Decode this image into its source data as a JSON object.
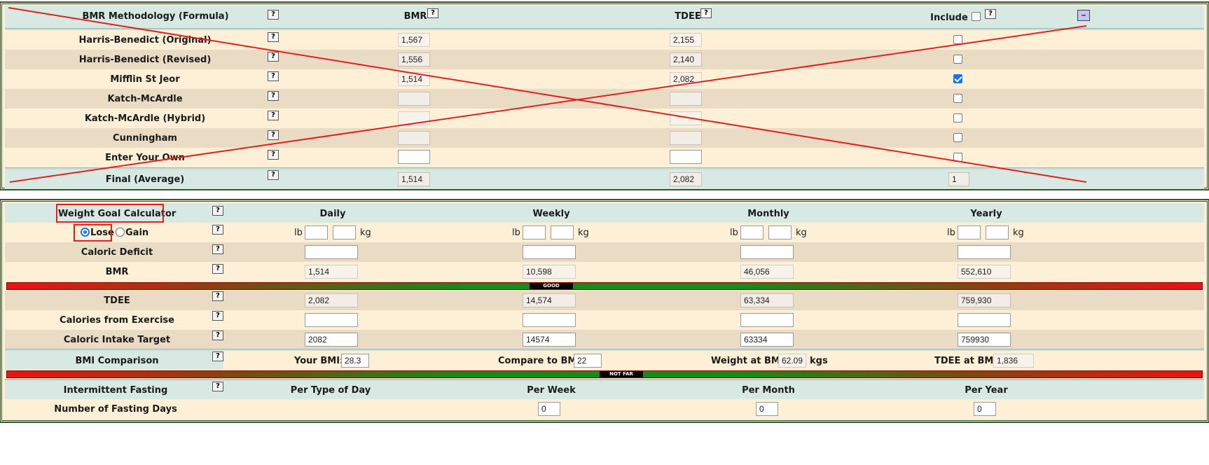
{
  "bmr_table": {
    "headers": {
      "method": "BMR Methodology (Formula)",
      "bmr": "BMR",
      "tdee": "TDEE",
      "include": "Include"
    },
    "help_glyph": "?",
    "collapse_glyph": "–",
    "rows": [
      {
        "name": "Harris-Benedict (Original)",
        "bmr": "1,567",
        "tdee": "2,155",
        "checked": false
      },
      {
        "name": "Harris-Benedict (Revised)",
        "bmr": "1,556",
        "tdee": "2,140",
        "checked": false
      },
      {
        "name": "Mifflin St Jeor",
        "bmr": "1,514",
        "tdee": "2,082",
        "checked": true
      },
      {
        "name": "Katch-McArdle",
        "bmr": "",
        "tdee": "",
        "checked": false
      },
      {
        "name": "Katch-McArdle (Hybrid)",
        "bmr": "",
        "tdee": "",
        "checked": false
      },
      {
        "name": "Cunningham",
        "bmr": "",
        "tdee": "",
        "checked": false
      },
      {
        "name": "Enter Your Own",
        "bmr": "",
        "tdee": "",
        "checked": false
      }
    ],
    "final": {
      "label": "Final (Average)",
      "bmr": "1,514",
      "tdee": "2,082",
      "count": "1"
    }
  },
  "weight_goal": {
    "title": "Weight Goal Calculator",
    "columns": [
      "Daily",
      "Weekly",
      "Monthly",
      "Yearly"
    ],
    "lose_label": "Lose",
    "gain_label": "Gain",
    "selected": "lose",
    "lb_unit": "lb",
    "kg_unit": "kg",
    "rows": {
      "caloric_deficit": {
        "label": "Caloric Deficit",
        "values": [
          "",
          "",
          "",
          ""
        ]
      },
      "bmr": {
        "label": "BMR",
        "values": [
          "1,514",
          "10,598",
          "46,056",
          "552,610"
        ]
      },
      "tdee": {
        "label": "TDEE",
        "values": [
          "2,082",
          "14,574",
          "63,334",
          "759,930"
        ]
      },
      "exercise": {
        "label": "Calories from Exercise",
        "values": [
          "",
          "",
          "",
          ""
        ]
      },
      "intake": {
        "label": "Caloric Intake Target",
        "values": [
          "2082",
          "14574",
          "63334",
          "759930"
        ]
      }
    },
    "bmr_bar_tag": "GOOD"
  },
  "bmi": {
    "title": "BMI Comparison",
    "your_bmi_label": "Your BMI:",
    "your_bmi": "28.3",
    "compare_label": "Compare to BMI:",
    "compare": "22",
    "weight_label": "Weight at BMI:",
    "weight": "62.09",
    "weight_unit": "kgs",
    "tdee_label": "TDEE at BMI:",
    "tdee": "1,836",
    "bar_tag": "NOT FAR"
  },
  "fasting": {
    "title": "Intermittent Fasting",
    "columns": [
      "Per Type of Day",
      "Per Week",
      "Per Month",
      "Per Year"
    ],
    "days_label": "Number of Fasting Days",
    "days": [
      "0",
      "0",
      "0"
    ]
  },
  "colors": {
    "header_bg": "#d8e9e4",
    "row_light": "#fdf0d6",
    "row_dark": "#eadbc4",
    "accent_red": "#e0201e",
    "checkbox_blue": "#1a73e8",
    "bar_green": "#178a17"
  }
}
